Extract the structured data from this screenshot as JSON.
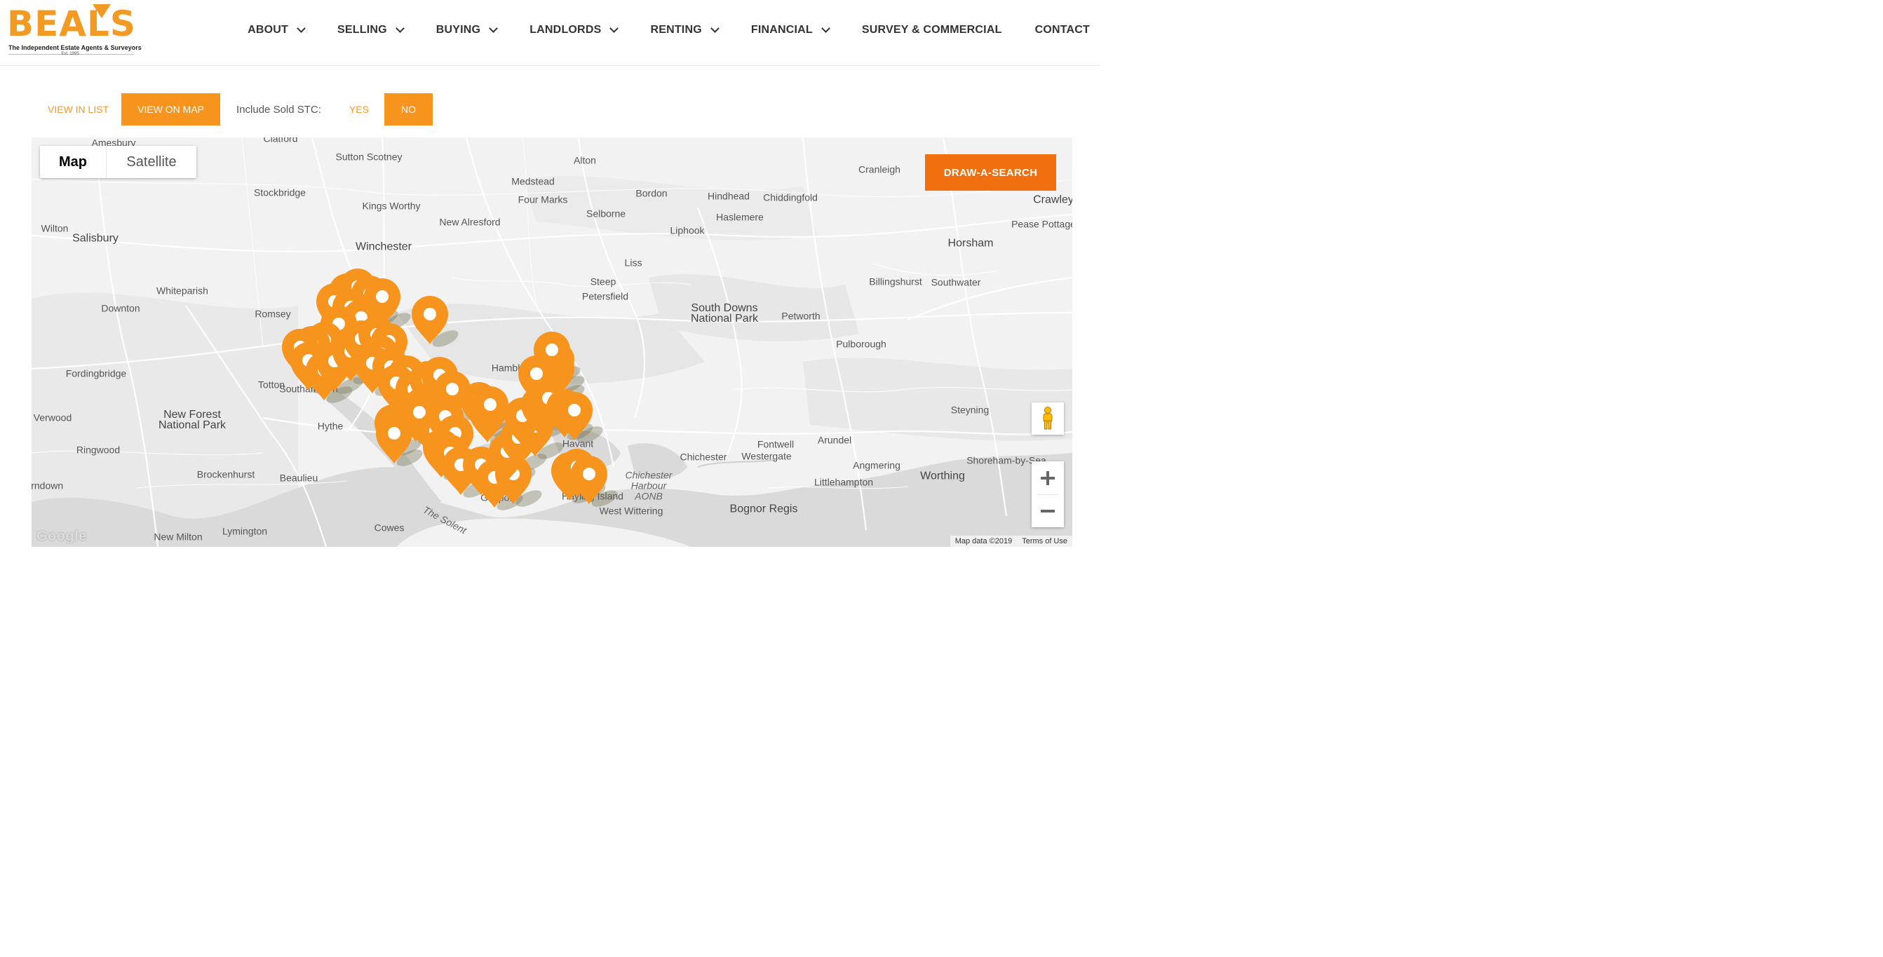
{
  "brand": {
    "name": "BEALS",
    "tagline": "The Independent Estate Agents & Surveyors",
    "established": "Est. 1995",
    "color": "#f39a24"
  },
  "nav": [
    {
      "label": "ABOUT",
      "dropdown": true
    },
    {
      "label": "SELLING",
      "dropdown": true
    },
    {
      "label": "BUYING",
      "dropdown": true
    },
    {
      "label": "LANDLORDS",
      "dropdown": true
    },
    {
      "label": "RENTING",
      "dropdown": true
    },
    {
      "label": "FINANCIAL",
      "dropdown": true
    },
    {
      "label": "SURVEY & COMMERCIAL",
      "dropdown": false
    },
    {
      "label": "CONTACT",
      "dropdown": false
    }
  ],
  "controls": {
    "view_list": "VIEW IN LIST",
    "view_map": "VIEW ON MAP",
    "sold_label": "Include Sold STC:",
    "yes": "YES",
    "no": "NO",
    "active_view": "map",
    "sold_selected": "no"
  },
  "map": {
    "type_map": "Map",
    "type_satellite": "Satellite",
    "draw_button": "DRAW-A-SEARCH",
    "attribution": "Map data ©2019",
    "terms": "Terms of Use",
    "google": "Google",
    "accent": "#f7941d",
    "draw_color": "#f16f0f",
    "places": [
      "Amesbury",
      "Clatford",
      "Sutton Scotney",
      "Alton",
      "Medstead",
      "Four Marks",
      "Bordon",
      "Cranleigh",
      "Crawley",
      "Hindhead",
      "Chiddingfold",
      "Stockbridge",
      "Kings Worthy",
      "New Alresford",
      "Selborne",
      "Haslemere",
      "Wilton",
      "Salisbury",
      "Pease Pottage",
      "Liphook",
      "Horsham",
      "Winchester",
      "Liss",
      "Whiteparish",
      "Steep",
      "Petersfield",
      "Billingshurst",
      "Southwater",
      "Downton",
      "Romsey",
      "South Downs National Park",
      "Petworth",
      "Pulborough",
      "Fordingbridge",
      "Totton",
      "Hamble",
      "Verwood",
      "New Forest National Park",
      "Hythe",
      "Ringwood",
      "Havant",
      "Fontwell",
      "Westergate",
      "Arundel",
      "Steyning",
      "Chichester Harbour AONB",
      "Brockenhurst",
      "Beaulieu",
      "West Wittering",
      "Angmering",
      "Littlehampton",
      "Worthing",
      "Shoreham-by-Sea",
      "Bognor Regis",
      "The Solent",
      "Cowes",
      "Lymington",
      "New Milton",
      "Southampton",
      "Gosport",
      "Hayling Island",
      "Chichester",
      "Ferndown"
    ],
    "listing_count": 60
  }
}
